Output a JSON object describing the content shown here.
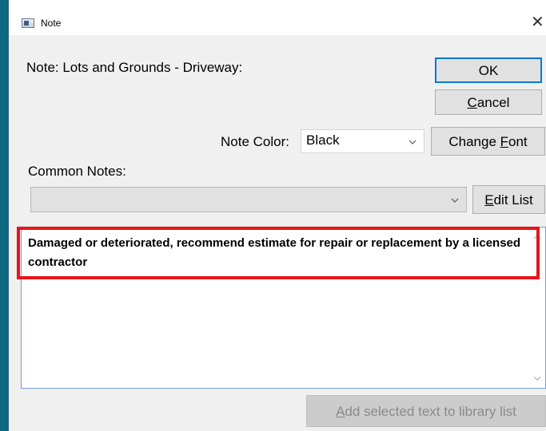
{
  "window": {
    "title": "Note",
    "close_glyph": "✕",
    "icon": "window-icon"
  },
  "form": {
    "note_label": "Note: Lots and Grounds - Driveway:",
    "note_color_label": "Note Color:",
    "note_color_value": "Black",
    "common_notes_label": "Common Notes:",
    "common_notes_value": "",
    "note_text": "Damaged or deteriorated, recommend estimate for repair or replacement by a licensed contractor"
  },
  "buttons": {
    "ok": "OK",
    "cancel_pre": "",
    "cancel_u": "C",
    "cancel_post": "ancel",
    "change_font_pre": "Change ",
    "change_font_u": "F",
    "change_font_post": "ont",
    "edit_list_pre": "",
    "edit_list_u": "E",
    "edit_list_post": "dit List",
    "add_library_pre": "",
    "add_library_u": "A",
    "add_library_post": "dd selected text to library list"
  },
  "icons": {
    "dropdown": "chevron-down-icon",
    "scroll_up": "scroll-up-arrow-icon",
    "scroll_down": "scroll-down-arrow-icon"
  },
  "colors": {
    "highlight": "#e8141b",
    "accent": "#0078d7",
    "backdrop": "#0b6a80"
  }
}
